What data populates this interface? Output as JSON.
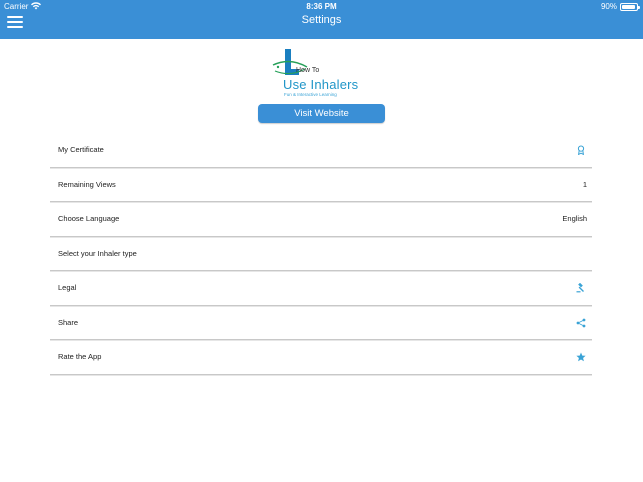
{
  "status_bar": {
    "carrier": "Carrier",
    "time": "8:36 PM",
    "battery": "90%"
  },
  "header": {
    "title": "Settings"
  },
  "logo": {
    "line1": "How To",
    "line2": "Use Inhalers",
    "line3": "Fun & Interactive Learning"
  },
  "visit_button": "Visit Website",
  "settings": [
    {
      "label": "My Certificate",
      "icon": "certificate-icon"
    },
    {
      "label": "Remaining Views",
      "value": "1"
    },
    {
      "label": "Choose Language",
      "value": "English"
    },
    {
      "label": "Select your Inhaler type"
    },
    {
      "label": "Legal",
      "icon": "gavel-icon"
    },
    {
      "label": "Share",
      "icon": "share-icon"
    },
    {
      "label": "Rate the App",
      "icon": "star-icon"
    }
  ],
  "colors": {
    "accent": "#3a8fd6",
    "icon": "#3aa3d6"
  }
}
